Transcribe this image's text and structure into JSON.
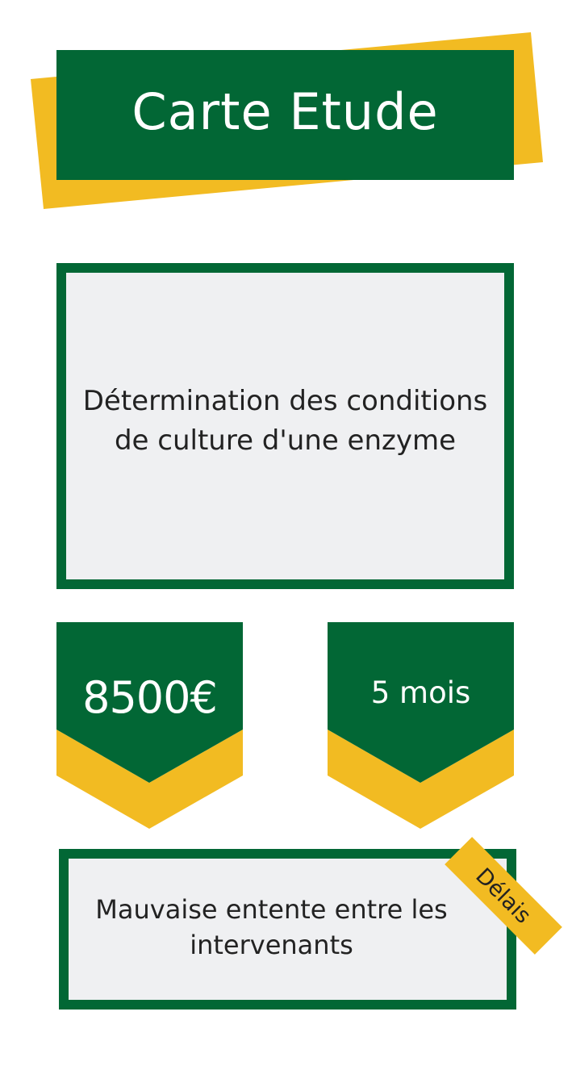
{
  "title": "Carte Etude",
  "study_subject": "Détermination des conditions de culture d'une enzyme",
  "budget": "8500€",
  "duration": "5 mois",
  "risk": {
    "category": "Délais",
    "description": "Mauvaise entente entre les intervenants"
  },
  "colors": {
    "brand_green": "#026735",
    "accent_yellow": "#f2bb22",
    "card_background": "#eff0f2"
  }
}
